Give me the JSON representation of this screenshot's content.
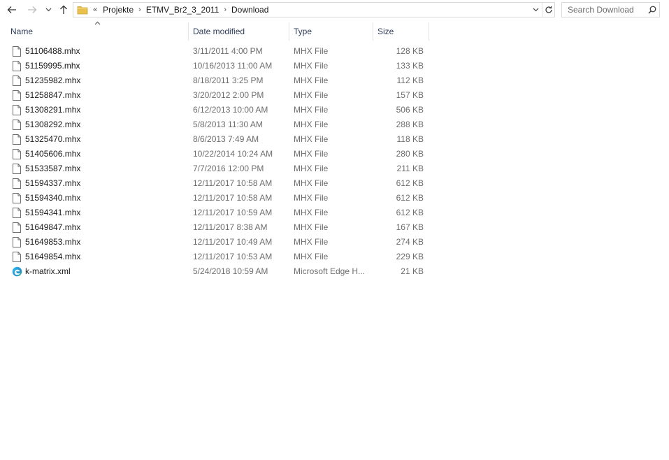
{
  "nav": {
    "back_icon": "back-arrow-icon",
    "forward_icon": "forward-arrow-icon",
    "recent_icon": "chevron-down-icon",
    "up_icon": "up-arrow-icon"
  },
  "address": {
    "overflow": "«",
    "crumbs": [
      "Projekte",
      "ETMV_Br2_3_2011",
      "Download"
    ],
    "separator": "›"
  },
  "search": {
    "placeholder": "Search Download"
  },
  "columns": {
    "name": "Name",
    "date": "Date modified",
    "type": "Type",
    "size": "Size"
  },
  "files": [
    {
      "name": "51106488.mhx",
      "date": "3/11/2011 4:00 PM",
      "type": "MHX File",
      "size": "128 KB",
      "icon": "file"
    },
    {
      "name": "51159995.mhx",
      "date": "10/16/2013 11:00 AM",
      "type": "MHX File",
      "size": "133 KB",
      "icon": "file"
    },
    {
      "name": "51235982.mhx",
      "date": "8/18/2011 3:25 PM",
      "type": "MHX File",
      "size": "112 KB",
      "icon": "file"
    },
    {
      "name": "51258847.mhx",
      "date": "3/20/2012 2:00 PM",
      "type": "MHX File",
      "size": "157 KB",
      "icon": "file"
    },
    {
      "name": "51308291.mhx",
      "date": "6/12/2013 10:00 AM",
      "type": "MHX File",
      "size": "506 KB",
      "icon": "file"
    },
    {
      "name": "51308292.mhx",
      "date": "5/8/2013 11:30 AM",
      "type": "MHX File",
      "size": "288 KB",
      "icon": "file"
    },
    {
      "name": "51325470.mhx",
      "date": "8/6/2013 7:49 AM",
      "type": "MHX File",
      "size": "118 KB",
      "icon": "file"
    },
    {
      "name": "51405606.mhx",
      "date": "10/22/2014 10:24 AM",
      "type": "MHX File",
      "size": "280 KB",
      "icon": "file"
    },
    {
      "name": "51533587.mhx",
      "date": "7/7/2016 12:00 PM",
      "type": "MHX File",
      "size": "211 KB",
      "icon": "file"
    },
    {
      "name": "51594337.mhx",
      "date": "12/11/2017 10:58 AM",
      "type": "MHX File",
      "size": "612 KB",
      "icon": "file"
    },
    {
      "name": "51594340.mhx",
      "date": "12/11/2017 10:58 AM",
      "type": "MHX File",
      "size": "612 KB",
      "icon": "file"
    },
    {
      "name": "51594341.mhx",
      "date": "12/11/2017 10:59 AM",
      "type": "MHX File",
      "size": "612 KB",
      "icon": "file"
    },
    {
      "name": "51649847.mhx",
      "date": "12/11/2017 8:38 AM",
      "type": "MHX File",
      "size": "167 KB",
      "icon": "file"
    },
    {
      "name": "51649853.mhx",
      "date": "12/11/2017 10:49 AM",
      "type": "MHX File",
      "size": "274 KB",
      "icon": "file"
    },
    {
      "name": "51649854.mhx",
      "date": "12/11/2017 10:53 AM",
      "type": "MHX File",
      "size": "229 KB",
      "icon": "file"
    },
    {
      "name": "k-matrix.xml",
      "date": "5/24/2018 10:59 AM",
      "type": "Microsoft Edge H...",
      "size": "21 KB",
      "icon": "edge"
    }
  ],
  "colors": {
    "header_text": "#2e3d5a",
    "secondary_text": "#6d6d6d",
    "folder": "#e8c04a"
  }
}
